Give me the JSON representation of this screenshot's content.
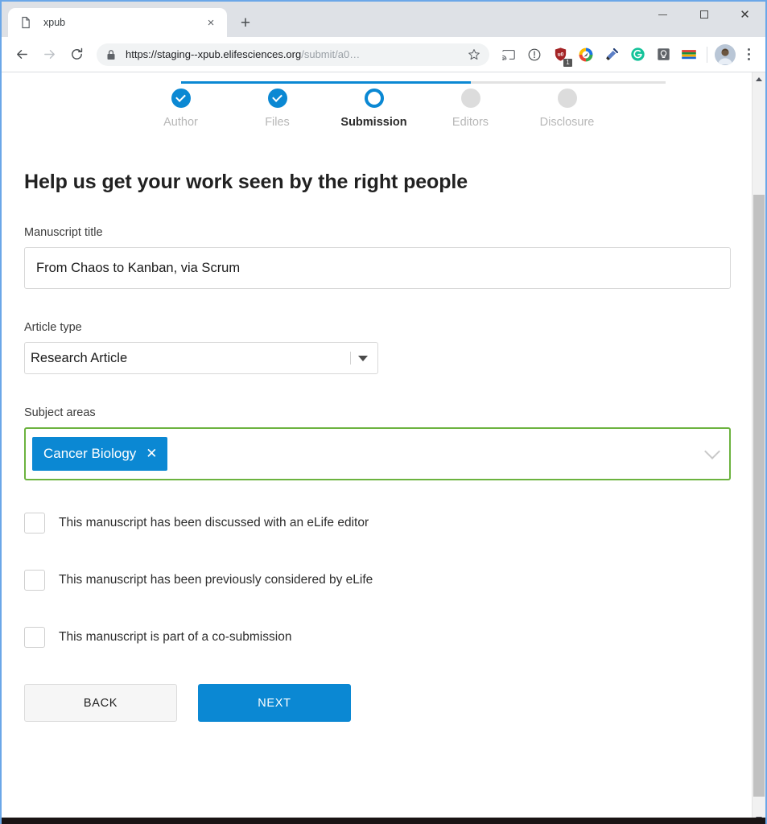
{
  "browser": {
    "tab": {
      "title": "xpub",
      "favicon": "page-icon",
      "close_label": "×",
      "new_tab_label": "+"
    },
    "window_controls": {
      "minimize": "minimize-icon",
      "maximize": "maximize-icon",
      "close": "close-icon"
    },
    "toolbar": {
      "back": "back-arrow-icon",
      "forward": "forward-arrow-icon",
      "reload": "reload-icon",
      "lock": "lock-icon",
      "url_domain": "https://staging--xpub.elifesciences.org",
      "url_path": "/submit/a0…",
      "bookmark": "star-icon",
      "extensions": [
        {
          "name": "cast-icon",
          "badge": ""
        },
        {
          "name": "info-circle-icon",
          "badge": ""
        },
        {
          "name": "ublock-origin-shield-icon",
          "badge": "1"
        },
        {
          "name": "color-circle-icon",
          "badge": ""
        },
        {
          "name": "eyedropper-icon",
          "badge": ""
        },
        {
          "name": "grammarly-icon",
          "badge": ""
        },
        {
          "name": "lightbulb-icon",
          "badge": ""
        },
        {
          "name": "color-stack-icon",
          "badge": ""
        }
      ],
      "profile": "avatar",
      "menu": "three-dot-menu-icon"
    }
  },
  "colors": {
    "accent_blue": "#0b88d3",
    "valid_green": "#6cb33f",
    "step_inactive": "#dcdcdc",
    "step_label_inactive": "#b7b7b7"
  },
  "stepper": {
    "steps": [
      {
        "label": "Author",
        "state": "done"
      },
      {
        "label": "Files",
        "state": "done"
      },
      {
        "label": "Submission",
        "state": "current"
      },
      {
        "label": "Editors",
        "state": "todo"
      },
      {
        "label": "Disclosure",
        "state": "todo"
      }
    ]
  },
  "form": {
    "heading": "Help us get your work seen by the right people",
    "manuscript_title": {
      "label": "Manuscript title",
      "value": "From Chaos to Kanban, via Scrum",
      "placeholder": ""
    },
    "article_type": {
      "label": "Article type",
      "value": "Research Article",
      "caret": "caret-down-icon"
    },
    "subject_areas": {
      "label": "Subject areas",
      "tags": [
        {
          "label": "Cancer Biology",
          "remove": "✕"
        }
      ],
      "chevron": "chevron-down-icon"
    },
    "checkboxes": [
      {
        "label": "This manuscript has been discussed with an eLife editor",
        "checked": false
      },
      {
        "label": "This manuscript has been previously considered by eLife",
        "checked": false
      },
      {
        "label": "This manuscript is part of a co-submission",
        "checked": false
      }
    ],
    "buttons": {
      "back": "BACK",
      "next": "NEXT"
    }
  }
}
